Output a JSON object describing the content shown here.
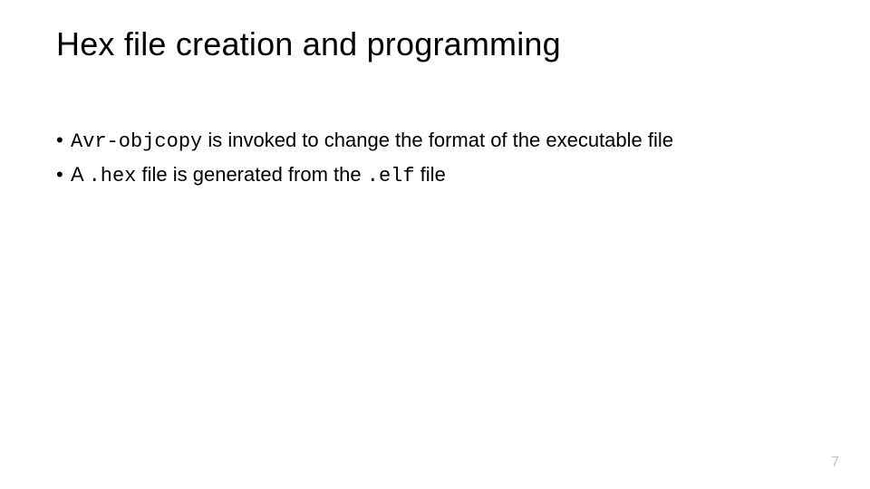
{
  "title": "Hex file creation and programming",
  "bullets": [
    {
      "code1": "Avr-objcopy",
      "text1_after": " is invoked to change the format of the executable file"
    },
    {
      "text2_before": "A ",
      "code2a": ".hex",
      "text2_mid": " file is generated from the ",
      "code2b": ".elf",
      "text2_after": " file"
    }
  ],
  "page_number": "7"
}
